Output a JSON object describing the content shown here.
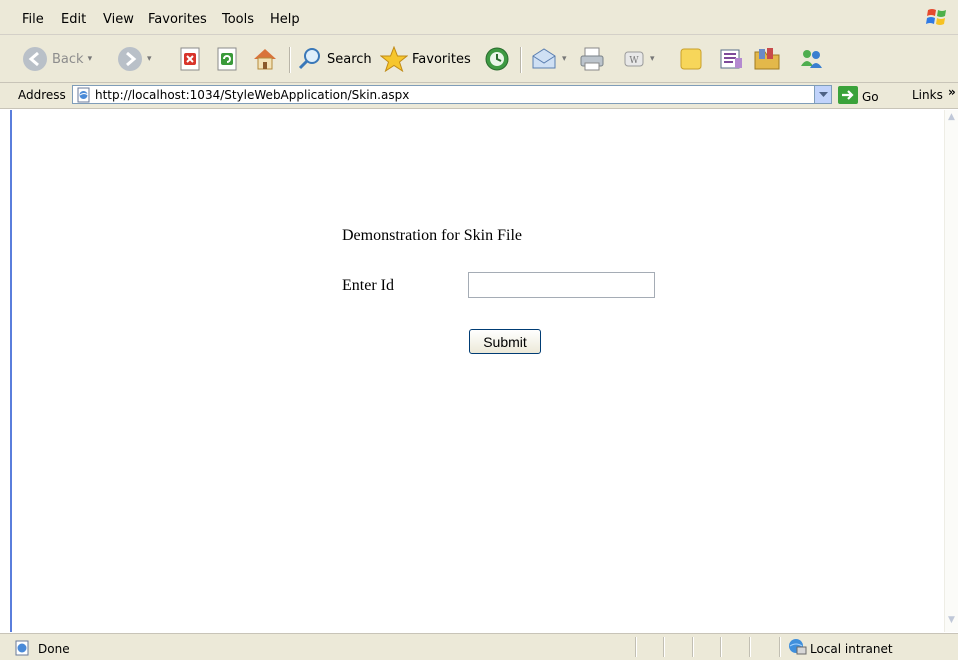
{
  "menu": {
    "items": [
      "File",
      "Edit",
      "View",
      "Favorites",
      "Tools",
      "Help"
    ]
  },
  "toolbar": {
    "back_label": "Back",
    "search_label": "Search",
    "favorites_label": "Favorites"
  },
  "address": {
    "label": "Address",
    "url": "http://localhost:1034/StyleWebApplication/Skin.aspx",
    "go_label": "Go",
    "links_label": "Links",
    "links_chevron": "»"
  },
  "page": {
    "heading": "Demonstration for Skin File",
    "id_label": "Enter Id",
    "id_value": "",
    "submit_label": "Submit"
  },
  "status": {
    "text": "Done",
    "zone": "Local intranet"
  },
  "icons": {
    "back": "back-arrow-icon",
    "forward": "forward-arrow-icon",
    "stop": "stop-icon",
    "refresh": "refresh-icon",
    "home": "home-icon",
    "search": "search-icon",
    "favorites": "favorites-star-icon",
    "history": "history-icon",
    "mail": "mail-icon",
    "print": "print-icon",
    "edit": "edit-icon",
    "discuss": "discuss-icon",
    "research": "research-icon",
    "messenger": "messenger-icon",
    "page": "page-icon",
    "zone": "intranet-icon"
  },
  "colors": {
    "chrome": "#ece9d8",
    "accent": "#5a7edc",
    "go_green": "#3aa23a"
  }
}
